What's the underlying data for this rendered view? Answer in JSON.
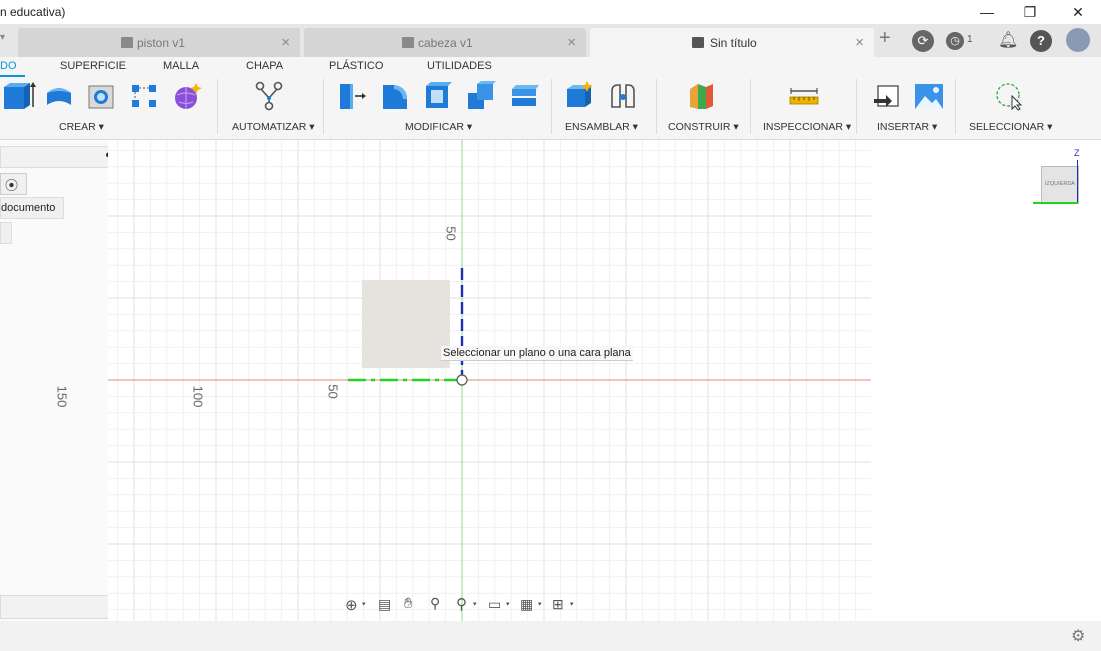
{
  "window": {
    "title": "n educativa)",
    "minimize": "—",
    "restore": "❐",
    "close": "✕"
  },
  "tabs": [
    {
      "label": "piston v1",
      "active": false
    },
    {
      "label": "cabeza v1",
      "active": false
    },
    {
      "label": "Sin título",
      "active": true
    }
  ],
  "top_icons": {
    "job_count": "1"
  },
  "ribbon": {
    "tabs": [
      "DO",
      "SUPERFICIE",
      "MALLA",
      "CHAPA",
      "PLÁSTICO",
      "UTILIDADES"
    ],
    "groups": [
      "CREAR ▾",
      "AUTOMATIZAR ▾",
      "MODIFICAR ▾",
      "ENSAMBLAR ▾",
      "CONSTRUIR ▾",
      "INSPECCIONAR ▾",
      "INSERTAR ▾",
      "SELECCIONAR ▾"
    ]
  },
  "browser": {
    "item_label": "documento"
  },
  "canvas": {
    "axis_labels": [
      "50",
      "50",
      "100",
      "150"
    ],
    "tooltip": "Seleccionar un plano o una cara plana"
  },
  "viewcube": {
    "face_label": "IZQUIERDA",
    "z_label": "Z"
  },
  "colors": {
    "accent": "#0696d7",
    "x_axis": "#e06d5b",
    "y_axis": "#6fd36a",
    "z_axis": "#1d2fb5",
    "sketch_green": "#22d422"
  }
}
